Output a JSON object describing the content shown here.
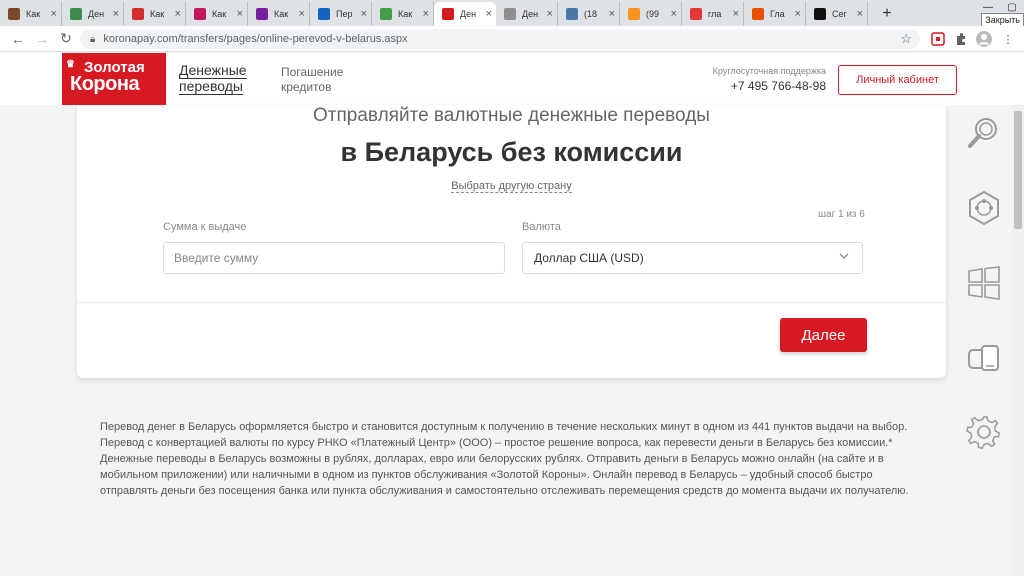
{
  "browser": {
    "tabs": [
      {
        "title": "Как",
        "icon": "hat-icon",
        "color": "#7a4a2a"
      },
      {
        "title": "Ден",
        "icon": "bag-icon",
        "color": "#3b8b4b"
      },
      {
        "title": "Как",
        "icon": "circle-icon",
        "color": "#d32f2f"
      },
      {
        "title": "Как",
        "icon": "squares-icon",
        "color": "#c2185b"
      },
      {
        "title": "Как",
        "icon": "v-icon",
        "color": "#7b1fa2"
      },
      {
        "title": "Пер",
        "icon": "folder-icon",
        "color": "#1565c0"
      },
      {
        "title": "Как",
        "icon": "arrow-icon",
        "color": "#43a047"
      },
      {
        "title": "Ден",
        "icon": "crown-icon",
        "color": "#d71a21",
        "active": true
      },
      {
        "title": "Ден",
        "icon": "doc-icon",
        "color": "#8e8e8e"
      },
      {
        "title": "(18",
        "icon": "vk-icon",
        "color": "#4a76a8"
      },
      {
        "title": "(99",
        "icon": "ok-icon",
        "color": "#f7931e"
      },
      {
        "title": "гла",
        "icon": "yandex-icon",
        "color": "#e53935"
      },
      {
        "title": "Гла",
        "icon": "crown-icon",
        "color": "#e65100"
      },
      {
        "title": "Сег",
        "icon": "a-icon",
        "color": "#111111"
      }
    ],
    "close_tooltip": "Закрыть",
    "url": "koronapay.com/transfers/pages/online-perevod-v-belarus.aspx"
  },
  "header": {
    "logo_line1": "Золотая",
    "logo_line2": "Корона",
    "nav_transfers": [
      "Денежные",
      "переводы"
    ],
    "nav_loans": [
      "Погашение",
      "кредитов"
    ],
    "support_label": "Круглосуточная поддержка",
    "support_phone": "+7 495 766-48-98",
    "cabinet_button": "Личный кабинет"
  },
  "form": {
    "subtitle": "Отправляйте валютные денежные переводы",
    "headline": "в Беларусь без комиссии",
    "change_country": "Выбрать другую страну",
    "step": "шаг 1 из 6",
    "amount_label": "Сумма к выдаче",
    "amount_placeholder": "Введите сумму",
    "amount_value": "",
    "currency_label": "Валюта",
    "currency_value": "Доллар США (USD)",
    "next_button": "Далее"
  },
  "description": "Перевод денег в Беларусь оформляется быстро и становится доступным к получению в течение нескольких минут в одном из 441 пунктов выдачи на выбор. Перевод с конвертацией валюты по курсу РНКО «Платежный Центр» (ООО) – простое решение вопроса, как перевести деньги в Беларусь без комиссии.* Денежные переводы в Беларусь возможны в рублях, долларах, евро или белорусских рублях. Отправить деньги в Беларусь можно онлайн (на сайте и в мобильном приложении) или наличными в одном из пунктов обслуживания «Золотой Короны». Онлайн перевод в Беларусь – удобный способ быстро отправлять деньги без посещения банка или пункта обслуживания и самостоятельно отслеживать перемещения средств до момента выдачи их получателю.",
  "side_panel": {
    "icons": [
      "magnifier-icon",
      "network-icon",
      "windows-icon",
      "devices-icon",
      "settings-gear-icon"
    ]
  },
  "colors": {
    "brand_red": "#d71a21"
  }
}
